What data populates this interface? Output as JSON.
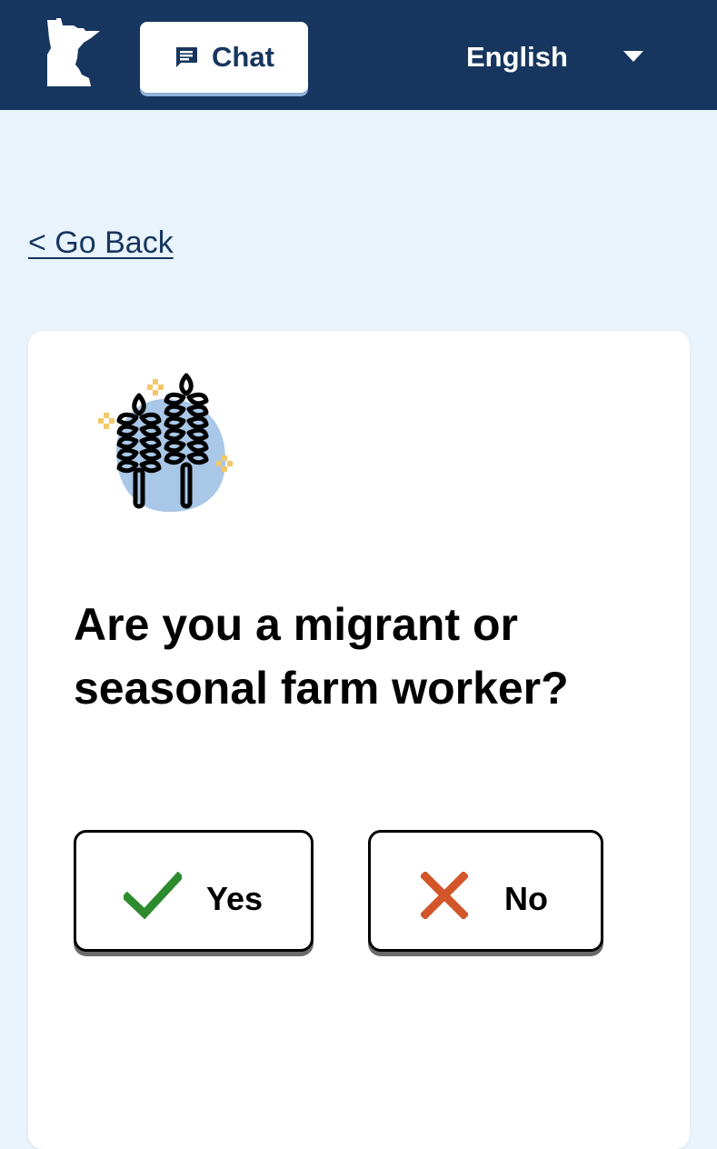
{
  "header": {
    "logo_icon": "minnesota-state-icon",
    "chat": {
      "icon": "chat-icon",
      "label": "Chat"
    },
    "language": {
      "selected": "English",
      "icon": "caret-down-icon"
    }
  },
  "nav": {
    "go_back_label": "< Go Back"
  },
  "question_card": {
    "illustration_icon": "wheat-icon",
    "question": "Are you a migrant or seasonal farm worker?",
    "answers": [
      {
        "label": "Yes",
        "icon": "check-icon",
        "color": "#2e8a2e"
      },
      {
        "label": "No",
        "icon": "x-icon",
        "color": "#d2562a"
      }
    ]
  },
  "colors": {
    "header_bg": "#17365f",
    "page_bg": "#e9f3fb",
    "card_bg": "#ffffff",
    "illustration_blob": "#a9c8e8",
    "sparkle": "#f2c86b"
  }
}
